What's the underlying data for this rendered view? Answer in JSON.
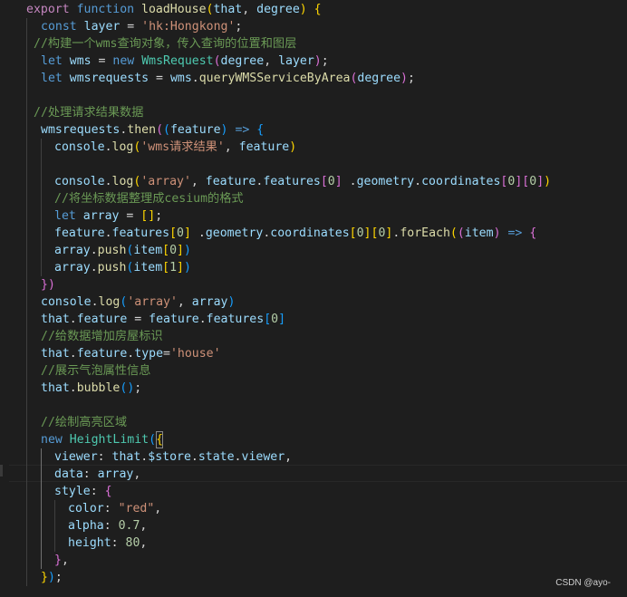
{
  "watermark": "CSDN @ayo-",
  "lines": [
    [
      [
        "kw2",
        "export "
      ],
      [
        "kw",
        "function "
      ],
      [
        "fn",
        "loadHouse"
      ],
      [
        "b1",
        "("
      ],
      [
        "var",
        "that"
      ],
      [
        "p",
        ", "
      ],
      [
        "var",
        "degree"
      ],
      [
        "b1",
        ")"
      ],
      [
        "p",
        " "
      ],
      [
        "b1",
        "{"
      ]
    ],
    [
      [
        "kw",
        "const "
      ],
      [
        "var",
        "layer"
      ],
      [
        "p",
        " = "
      ],
      [
        "str",
        "'hk:Hongkong'"
      ],
      [
        "p",
        ";"
      ]
    ],
    [
      [
        "cm",
        "//构建一个wms查询对象，传入查询的位置和图层"
      ]
    ],
    [
      [
        "kw",
        "let "
      ],
      [
        "var",
        "wms"
      ],
      [
        "p",
        " = "
      ],
      [
        "kw",
        "new "
      ],
      [
        "cls",
        "WmsRequest"
      ],
      [
        "b2",
        "("
      ],
      [
        "var",
        "degree"
      ],
      [
        "p",
        ", "
      ],
      [
        "var",
        "layer"
      ],
      [
        "b2",
        ")"
      ],
      [
        "p",
        ";"
      ]
    ],
    [
      [
        "kw",
        "let "
      ],
      [
        "var",
        "wmsrequests"
      ],
      [
        "p",
        " = "
      ],
      [
        "var",
        "wms"
      ],
      [
        "p",
        "."
      ],
      [
        "fn",
        "queryWMSServiceByArea"
      ],
      [
        "b2",
        "("
      ],
      [
        "var",
        "degree"
      ],
      [
        "b2",
        ")"
      ],
      [
        "p",
        ";"
      ]
    ],
    [],
    [
      [
        "cm",
        "//处理请求结果数据"
      ]
    ],
    [
      [
        "var",
        "wmsrequests"
      ],
      [
        "p",
        "."
      ],
      [
        "fn",
        "then"
      ],
      [
        "b2",
        "("
      ],
      [
        "b3",
        "("
      ],
      [
        "var",
        "feature"
      ],
      [
        "b3",
        ")"
      ],
      [
        "p",
        " "
      ],
      [
        "kw",
        "=>"
      ],
      [
        "p",
        " "
      ],
      [
        "b3",
        "{"
      ]
    ],
    [
      [
        "var",
        "console"
      ],
      [
        "p",
        "."
      ],
      [
        "fn",
        "log"
      ],
      [
        "b1",
        "("
      ],
      [
        "str",
        "'wms请求结果'"
      ],
      [
        "p",
        ", "
      ],
      [
        "var",
        "feature"
      ],
      [
        "b1",
        ")"
      ]
    ],
    [],
    [
      [
        "var",
        "console"
      ],
      [
        "p",
        "."
      ],
      [
        "fn",
        "log"
      ],
      [
        "b1",
        "("
      ],
      [
        "str",
        "'array'"
      ],
      [
        "p",
        ", "
      ],
      [
        "var",
        "feature"
      ],
      [
        "p",
        "."
      ],
      [
        "var",
        "features"
      ],
      [
        "b2",
        "["
      ],
      [
        "num",
        "0"
      ],
      [
        "b2",
        "]"
      ],
      [
        "p",
        " ."
      ],
      [
        "var",
        "geometry"
      ],
      [
        "p",
        "."
      ],
      [
        "var",
        "coordinates"
      ],
      [
        "b2",
        "["
      ],
      [
        "num",
        "0"
      ],
      [
        "b2",
        "]"
      ],
      [
        "b2",
        "["
      ],
      [
        "num",
        "0"
      ],
      [
        "b2",
        "]"
      ],
      [
        "b1",
        ")"
      ]
    ],
    [
      [
        "cm",
        "//将坐标数据整理成cesium的格式"
      ]
    ],
    [
      [
        "kw",
        "let "
      ],
      [
        "var",
        "array"
      ],
      [
        "p",
        " = "
      ],
      [
        "b1",
        "[]"
      ],
      [
        "p",
        ";"
      ]
    ],
    [
      [
        "var",
        "feature"
      ],
      [
        "p",
        "."
      ],
      [
        "var",
        "features"
      ],
      [
        "b1",
        "["
      ],
      [
        "num",
        "0"
      ],
      [
        "b1",
        "]"
      ],
      [
        "p",
        " ."
      ],
      [
        "var",
        "geometry"
      ],
      [
        "p",
        "."
      ],
      [
        "var",
        "coordinates"
      ],
      [
        "b1",
        "["
      ],
      [
        "num",
        "0"
      ],
      [
        "b1",
        "]"
      ],
      [
        "b1",
        "["
      ],
      [
        "num",
        "0"
      ],
      [
        "b1",
        "]"
      ],
      [
        "p",
        "."
      ],
      [
        "fn",
        "forEach"
      ],
      [
        "b1",
        "("
      ],
      [
        "b2",
        "("
      ],
      [
        "var",
        "item"
      ],
      [
        "b2",
        ")"
      ],
      [
        "p",
        " "
      ],
      [
        "kw",
        "=>"
      ],
      [
        "p",
        " "
      ],
      [
        "b2",
        "{"
      ]
    ],
    [
      [
        "var",
        "array"
      ],
      [
        "p",
        "."
      ],
      [
        "fn",
        "push"
      ],
      [
        "b3",
        "("
      ],
      [
        "var",
        "item"
      ],
      [
        "b1",
        "["
      ],
      [
        "num",
        "0"
      ],
      [
        "b1",
        "]"
      ],
      [
        "b3",
        ")"
      ]
    ],
    [
      [
        "var",
        "array"
      ],
      [
        "p",
        "."
      ],
      [
        "fn",
        "push"
      ],
      [
        "b3",
        "("
      ],
      [
        "var",
        "item"
      ],
      [
        "b1",
        "["
      ],
      [
        "num",
        "1"
      ],
      [
        "b1",
        "]"
      ],
      [
        "b3",
        ")"
      ]
    ],
    [
      [
        "b2",
        "})"
      ]
    ],
    [
      [
        "var",
        "console"
      ],
      [
        "p",
        "."
      ],
      [
        "fn",
        "log"
      ],
      [
        "b3",
        "("
      ],
      [
        "str",
        "'array'"
      ],
      [
        "p",
        ", "
      ],
      [
        "var",
        "array"
      ],
      [
        "b3",
        ")"
      ]
    ],
    [
      [
        "var",
        "that"
      ],
      [
        "p",
        "."
      ],
      [
        "var",
        "feature"
      ],
      [
        "p",
        " = "
      ],
      [
        "var",
        "feature"
      ],
      [
        "p",
        "."
      ],
      [
        "var",
        "features"
      ],
      [
        "b3",
        "["
      ],
      [
        "num",
        "0"
      ],
      [
        "b3",
        "]"
      ]
    ],
    [
      [
        "cm",
        "//给数据增加房屋标识"
      ]
    ],
    [
      [
        "var",
        "that"
      ],
      [
        "p",
        "."
      ],
      [
        "var",
        "feature"
      ],
      [
        "p",
        "."
      ],
      [
        "var",
        "type"
      ],
      [
        "p",
        "="
      ],
      [
        "str",
        "'house'"
      ]
    ],
    [
      [
        "cm",
        "//展示气泡属性信息"
      ]
    ],
    [
      [
        "var",
        "that"
      ],
      [
        "p",
        "."
      ],
      [
        "fn",
        "bubble"
      ],
      [
        "b3",
        "("
      ],
      [
        "b3",
        ")"
      ],
      [
        "p",
        ";"
      ]
    ],
    [],
    [
      [
        "cm",
        "//绘制高亮区域"
      ]
    ],
    [
      [
        "kw",
        "new "
      ],
      [
        "cls",
        "HeightLimit"
      ],
      [
        "b3",
        "("
      ],
      [
        "b1",
        "{"
      ]
    ],
    [
      [
        "var",
        "viewer"
      ],
      [
        "p",
        ": "
      ],
      [
        "var",
        "that"
      ],
      [
        "p",
        "."
      ],
      [
        "var",
        "$store"
      ],
      [
        "p",
        "."
      ],
      [
        "var",
        "state"
      ],
      [
        "p",
        "."
      ],
      [
        "var",
        "viewer"
      ],
      [
        "p",
        ","
      ]
    ],
    [
      [
        "var",
        "data"
      ],
      [
        "p",
        ": "
      ],
      [
        "var",
        "array"
      ],
      [
        "p",
        ","
      ]
    ],
    [
      [
        "var",
        "style"
      ],
      [
        "p",
        ": "
      ],
      [
        "b2",
        "{"
      ]
    ],
    [
      [
        "var",
        "color"
      ],
      [
        "p",
        ": "
      ],
      [
        "str",
        "\"red\""
      ],
      [
        "p",
        ","
      ]
    ],
    [
      [
        "var",
        "alpha"
      ],
      [
        "p",
        ": "
      ],
      [
        "num",
        "0.7"
      ],
      [
        "p",
        ","
      ]
    ],
    [
      [
        "var",
        "height"
      ],
      [
        "p",
        ": "
      ],
      [
        "num",
        "80"
      ],
      [
        "p",
        ","
      ]
    ],
    [
      [
        "b2",
        "}"
      ],
      [
        "p",
        ","
      ]
    ],
    [
      [
        "b1",
        "}"
      ],
      [
        "b3",
        ")"
      ],
      [
        "p",
        ";"
      ]
    ]
  ]
}
